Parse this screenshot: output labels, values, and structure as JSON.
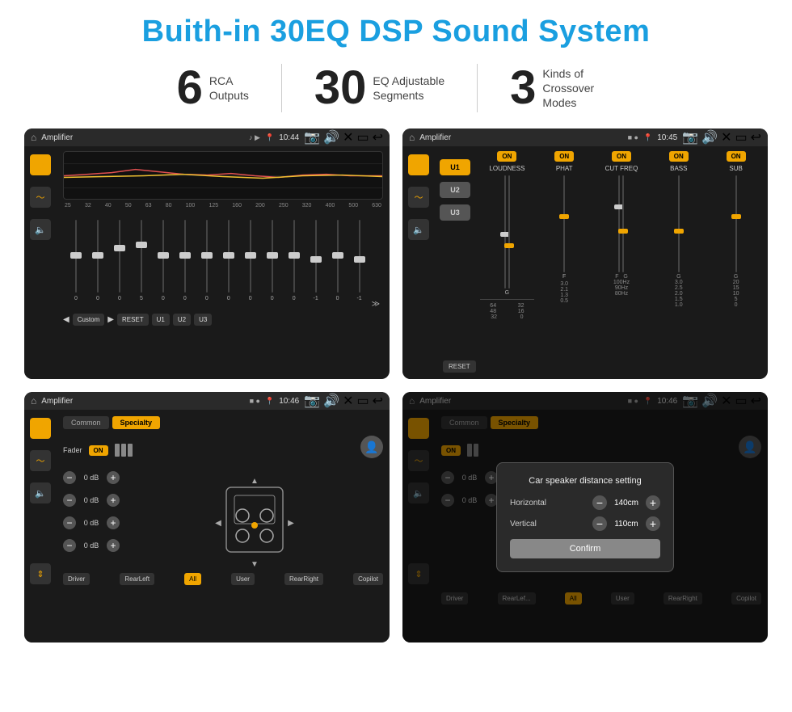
{
  "page": {
    "title": "Buith-in 30EQ DSP Sound System"
  },
  "stats": [
    {
      "number": "6",
      "label": "RCA\nOutputs"
    },
    {
      "number": "30",
      "label": "EQ Adjustable\nSegments"
    },
    {
      "number": "3",
      "label": "Kinds of\nCrossover Modes"
    }
  ],
  "screens": [
    {
      "id": "screen1",
      "topbar": {
        "title": "Amplifier",
        "time": "10:44"
      },
      "type": "eq",
      "freqLabels": [
        "25",
        "32",
        "40",
        "50",
        "63",
        "80",
        "100",
        "125",
        "160",
        "200",
        "250",
        "320",
        "400",
        "500",
        "630"
      ],
      "sliderValues": [
        "0",
        "0",
        "0",
        "5",
        "0",
        "0",
        "0",
        "0",
        "0",
        "0",
        "0",
        "-1",
        "0",
        "-1"
      ],
      "bottomButtons": [
        "Custom",
        "RESET",
        "U1",
        "U2",
        "U3"
      ]
    },
    {
      "id": "screen2",
      "topbar": {
        "title": "Amplifier",
        "time": "10:45"
      },
      "type": "amp",
      "uButtons": [
        "U1",
        "U2",
        "U3"
      ],
      "controls": [
        {
          "label": "LOUDNESS",
          "on": true
        },
        {
          "label": "PHAT",
          "on": true
        },
        {
          "label": "CUT FREQ",
          "on": true
        },
        {
          "label": "BASS",
          "on": true
        },
        {
          "label": "SUB",
          "on": true
        }
      ],
      "resetBtn": "RESET"
    },
    {
      "id": "screen3",
      "topbar": {
        "title": "Amplifier",
        "time": "10:46"
      },
      "type": "fader",
      "tabs": [
        {
          "label": "Common",
          "active": false
        },
        {
          "label": "Specialty",
          "active": true
        }
      ],
      "faderLabel": "Fader",
      "onBtn": "ON",
      "channelRows": [
        {
          "value": "0 dB"
        },
        {
          "value": "0 dB"
        },
        {
          "value": "0 dB"
        },
        {
          "value": "0 dB"
        }
      ],
      "bottomLabels": [
        "Driver",
        "RearLeft",
        "All",
        "User",
        "RearRight",
        "Copilot"
      ]
    },
    {
      "id": "screen4",
      "topbar": {
        "title": "Amplifier",
        "time": "10:46"
      },
      "type": "fader-dialog",
      "tabs": [
        {
          "label": "Common",
          "active": false
        },
        {
          "label": "Specialty",
          "active": true
        }
      ],
      "dialog": {
        "title": "Car speaker distance setting",
        "fields": [
          {
            "label": "Horizontal",
            "value": "140cm"
          },
          {
            "label": "Vertical",
            "value": "110cm"
          }
        ],
        "confirmLabel": "Confirm"
      },
      "bottomLabels": [
        "Driver",
        "RearLef...",
        "All",
        "User",
        "RearRight",
        "Copilot"
      ],
      "channelRows": [
        {
          "value": "0 dB"
        },
        {
          "value": "0 dB"
        }
      ]
    }
  ]
}
